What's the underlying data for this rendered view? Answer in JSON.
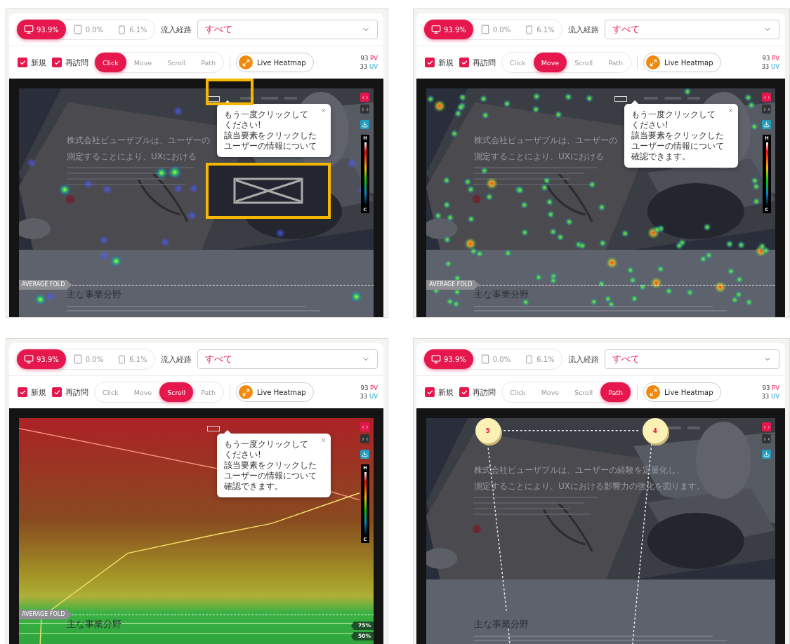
{
  "panels": [
    {
      "devices": [
        {
          "kind": "desktop",
          "value": "93.9%",
          "selected": true
        },
        {
          "kind": "tablet",
          "value": "0.0%",
          "selected": false
        },
        {
          "kind": "mobile",
          "value": "6.1%",
          "selected": false
        }
      ],
      "source": {
        "label": "流入経路",
        "value": "すべて"
      },
      "filters": [
        {
          "label": "新規",
          "checked": true
        },
        {
          "label": "再訪問",
          "checked": true
        }
      ],
      "modes": [
        {
          "label": "Click",
          "selected": true
        },
        {
          "label": "Move",
          "selected": false
        },
        {
          "label": "Scroll",
          "selected": false
        },
        {
          "label": "Path",
          "selected": false
        }
      ],
      "live_button": "Live Heatmap",
      "stats": [
        {
          "value": "93",
          "unit": "PV"
        },
        {
          "value": "33",
          "unit": "UV"
        }
      ],
      "preview": {
        "kind": "click",
        "highlighted": true,
        "headline": [
          "株式会社ビューザブルは、ユーザーの",
          "測定することにより、UXにおける"
        ],
        "section_title": "主な事業分野",
        "fold_label": "AVERAGE FOLD",
        "tooltip": [
          "もう一度クリックして",
          "ください!",
          "該当要素をクリックした",
          "ユーザーの情報について"
        ],
        "legend": {
          "high": "H",
          "low": "C"
        }
      }
    },
    {
      "devices": [
        {
          "kind": "desktop",
          "value": "93.9%",
          "selected": true
        },
        {
          "kind": "tablet",
          "value": "0.0%",
          "selected": false
        },
        {
          "kind": "mobile",
          "value": "6.1%",
          "selected": false
        }
      ],
      "source": {
        "label": "流入経路",
        "value": "すべて"
      },
      "filters": [
        {
          "label": "新規",
          "checked": true
        },
        {
          "label": "再訪問",
          "checked": true
        }
      ],
      "modes": [
        {
          "label": "Click",
          "selected": false
        },
        {
          "label": "Move",
          "selected": true
        },
        {
          "label": "Scroll",
          "selected": false
        },
        {
          "label": "Path",
          "selected": false
        }
      ],
      "live_button": "Live Heatmap",
      "stats": [
        {
          "value": "93",
          "unit": "PV"
        },
        {
          "value": "33",
          "unit": "UV"
        }
      ],
      "preview": {
        "kind": "move",
        "highlighted": false,
        "headline": [
          "株式会社ビューザブルは、ユーザーの",
          "測定することにより、UXにおける"
        ],
        "section_title": "主な事業分野",
        "fold_label": "AVERAGE FOLD",
        "tooltip": [
          "もう一度クリックして",
          "ください!",
          "該当要素をクリックした",
          "ユーザーの情報について",
          "確認できます。"
        ],
        "legend": {
          "high": "H",
          "low": "C"
        }
      }
    },
    {
      "devices": [
        {
          "kind": "desktop",
          "value": "93.9%",
          "selected": true
        },
        {
          "kind": "tablet",
          "value": "0.0%",
          "selected": false
        },
        {
          "kind": "mobile",
          "value": "6.1%",
          "selected": false
        }
      ],
      "source": {
        "label": "流入経路",
        "value": "すべて"
      },
      "filters": [
        {
          "label": "新規",
          "checked": true
        },
        {
          "label": "再訪問",
          "checked": true
        }
      ],
      "modes": [
        {
          "label": "Click",
          "selected": false
        },
        {
          "label": "Move",
          "selected": false
        },
        {
          "label": "Scroll",
          "selected": true
        },
        {
          "label": "Path",
          "selected": false
        }
      ],
      "live_button": "Live Heatmap",
      "stats": [
        {
          "value": "93",
          "unit": "PV"
        },
        {
          "value": "33",
          "unit": "UV"
        }
      ],
      "preview": {
        "kind": "scroll",
        "highlighted": false,
        "section_title": "主な事業分野",
        "fold_label": "AVERAGE FOLD",
        "tooltip": [
          "もう一度クリックして",
          "ください!",
          "該当要素をクリックした",
          "ユーザーの情報について",
          "確認できます。"
        ],
        "legend": {
          "high": "H",
          "low": "C"
        },
        "badges": [
          "75%",
          "50%"
        ]
      }
    },
    {
      "devices": [
        {
          "kind": "desktop",
          "value": "93.9%",
          "selected": true
        },
        {
          "kind": "tablet",
          "value": "0.0%",
          "selected": false
        },
        {
          "kind": "mobile",
          "value": "6.1%",
          "selected": false
        }
      ],
      "source": {
        "label": "流入経路",
        "value": "すべて"
      },
      "filters": [
        {
          "label": "新規",
          "checked": true
        },
        {
          "label": "再訪問",
          "checked": true
        }
      ],
      "modes": [
        {
          "label": "Click",
          "selected": false
        },
        {
          "label": "Move",
          "selected": false
        },
        {
          "label": "Scroll",
          "selected": false
        },
        {
          "label": "Path",
          "selected": true
        }
      ],
      "live_button": "Live Heatmap",
      "stats": [
        {
          "value": "93",
          "unit": "PV"
        },
        {
          "value": "33",
          "unit": "UV"
        }
      ],
      "preview": {
        "kind": "path",
        "highlighted": false,
        "headline": [
          "株式会社ビューザブルは、ユーザーの経験を定量化し、",
          "測定することにより、UXにおける影響力の強化を図ります。"
        ],
        "section_title": "主な事業分野",
        "nodes": [
          "5",
          "4"
        ]
      }
    }
  ]
}
